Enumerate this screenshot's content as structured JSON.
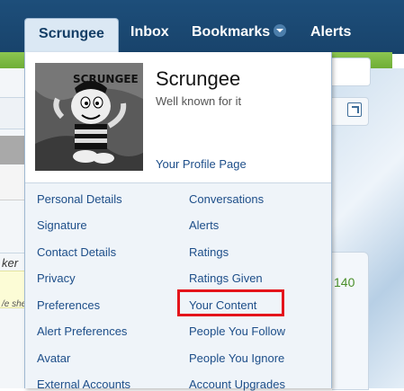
{
  "nav": {
    "tabs": [
      {
        "label": "Scrungee"
      },
      {
        "label": "Inbox"
      },
      {
        "label": "Bookmarks"
      },
      {
        "label": "Alerts"
      }
    ]
  },
  "background": {
    "number": "140",
    "italic_text": "ker",
    "italic_text2": "/e she"
  },
  "user": {
    "name": "Scrungee",
    "title": "Well known for it",
    "profile_link": "Your Profile Page"
  },
  "menu": {
    "left": [
      "Personal Details",
      "Signature",
      "Contact Details",
      "Privacy",
      "Preferences",
      "Alert Preferences",
      "Avatar",
      "External Accounts"
    ],
    "right": [
      "Conversations",
      "Alerts",
      "Ratings",
      "Ratings Given",
      "Your Content",
      "People You Follow",
      "People You Ignore",
      "Account Upgrades"
    ]
  },
  "colors": {
    "nav_bg": "#1d4e7a",
    "link": "#1d4e89",
    "highlight": "#e4141b",
    "green": "#8cc651"
  }
}
